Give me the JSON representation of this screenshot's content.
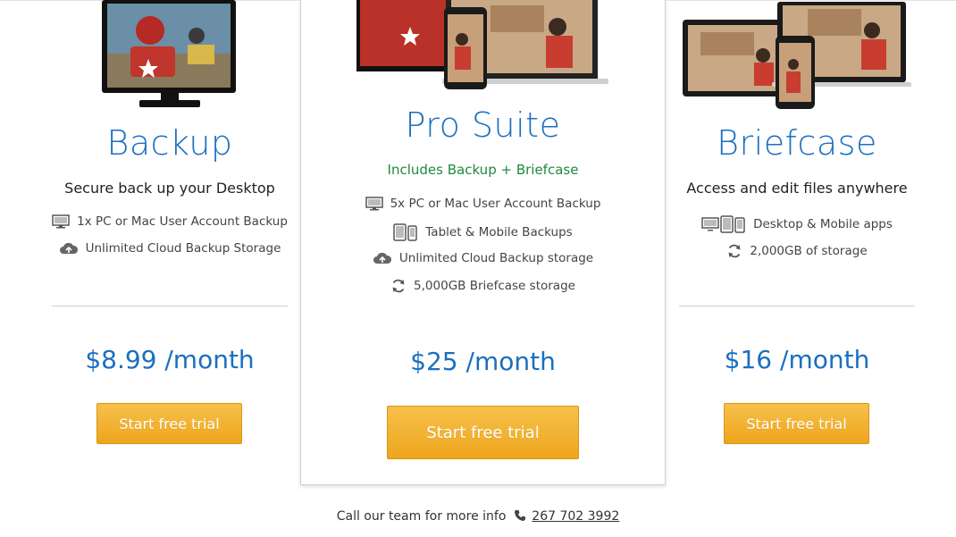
{
  "plans": [
    {
      "title": "Backup",
      "subtitle": "Secure back up your Desktop",
      "features": [
        {
          "icon": "monitor-icon",
          "text": "1x PC or Mac User Account Backup"
        },
        {
          "icon": "cloud-upload-icon",
          "text": "Unlimited Cloud Backup Storage"
        }
      ],
      "price": "$8.99 /month",
      "cta": "Start free trial"
    },
    {
      "title": "Pro Suite",
      "includes": "Includes Backup + Briefcase",
      "features": [
        {
          "icon": "monitor-icon",
          "text": "5x PC or Mac User Account Backup"
        },
        {
          "icon": "tablet-mobile-icon",
          "text": "Tablet & Mobile Backups"
        },
        {
          "icon": "cloud-upload-icon",
          "text": "Unlimited Cloud Backup storage"
        },
        {
          "icon": "sync-icon",
          "text": "5,000GB Briefcase storage"
        }
      ],
      "price": "$25 /month",
      "cta": "Start free trial"
    },
    {
      "title": "Briefcase",
      "subtitle": "Access and edit files anywhere",
      "features": [
        {
          "icon": "devices-icon",
          "text": "Desktop & Mobile apps"
        },
        {
          "icon": "sync-icon",
          "text": "2,000GB of storage"
        }
      ],
      "price": "$16 /month",
      "cta": "Start free trial"
    }
  ],
  "footer": {
    "text": "Call our team for more info",
    "phone": "267 702 3992"
  },
  "colors": {
    "title_blue": "#1a6fc0",
    "includes_green": "#1f8a3c",
    "button_orange": "#eea51e"
  }
}
